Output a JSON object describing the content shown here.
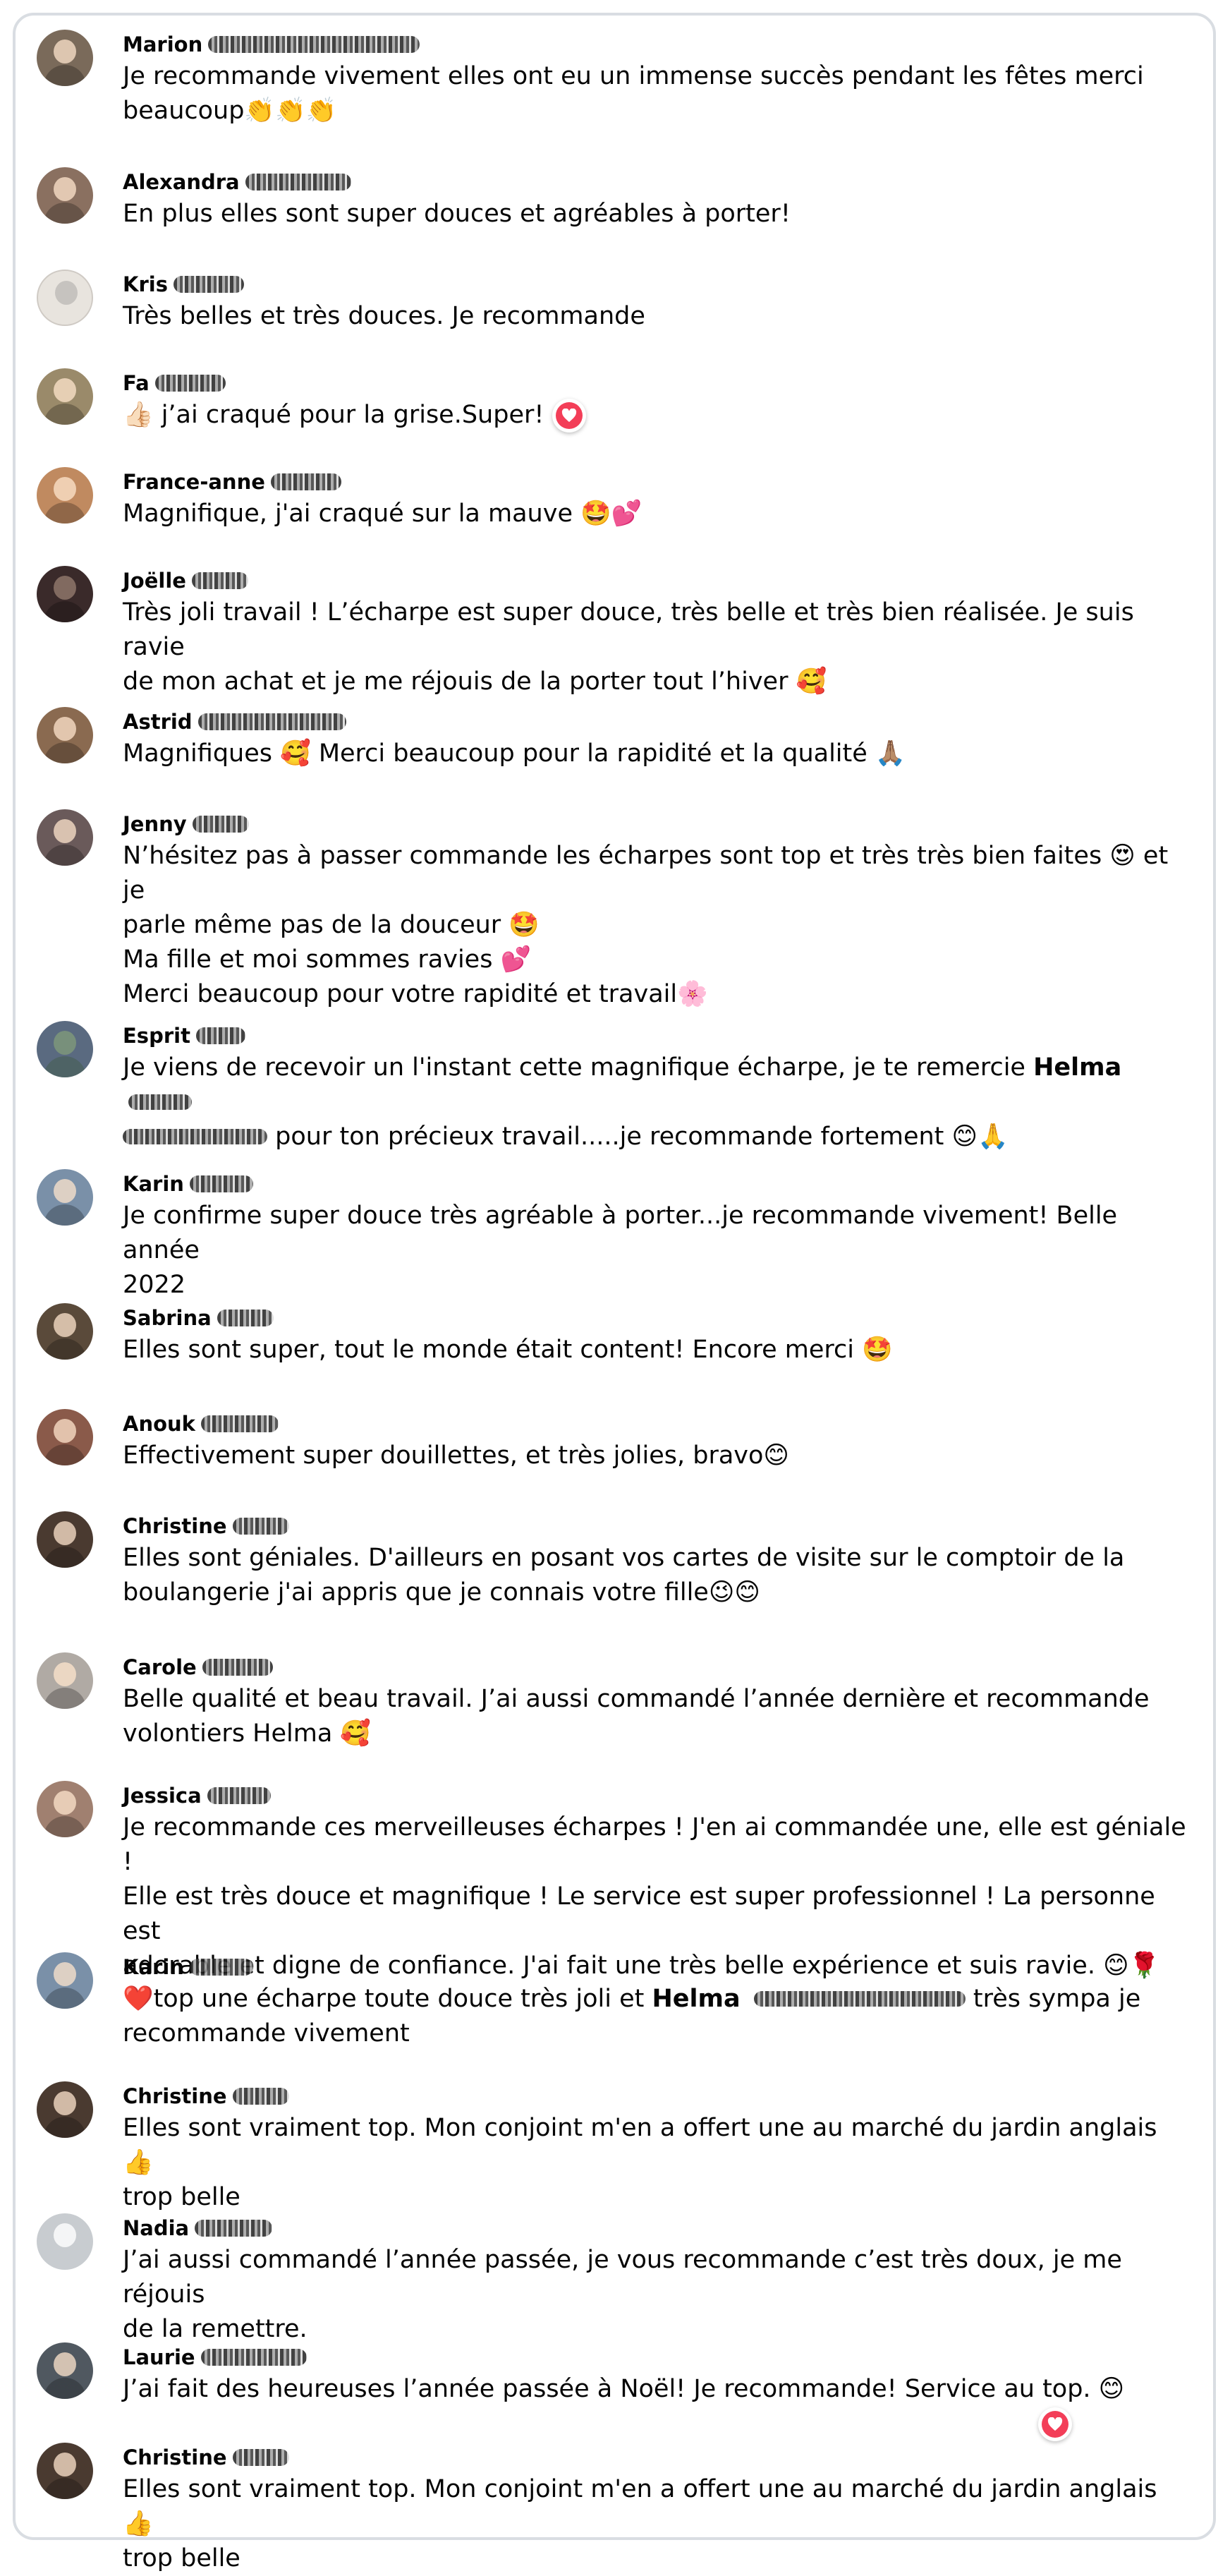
{
  "comments": [
    {
      "name": "Marion",
      "text": "Je recommande vivement elles ont eu un immense succès pendant les fêtes merci\nbeaucoup👏👏👏",
      "avatar_color": "#7a6a5a"
    },
    {
      "name": "Alexandra",
      "text": "En plus elles sont super douces et agréables à porter!",
      "avatar_color": "#8a7060"
    },
    {
      "name": "Kris",
      "text": "Très belles et très douces. Je recommande",
      "avatar_color": "#e8e4de"
    },
    {
      "name": "Fa",
      "text": "👍🏻 j’ai craqué pour la grise.Super!",
      "avatar_color": "#9a8a6a"
    },
    {
      "name": "France-anne",
      "text": "Magnifique, j'ai craqué sur la mauve 🤩💕",
      "avatar_color": "#c08a60"
    },
    {
      "name": "Joëlle",
      "text": "Très joli travail ! L’écharpe est super douce, très belle et très bien réalisée. Je suis ravie\nde mon achat et je me réjouis de la porter tout l’hiver 🥰",
      "avatar_color": "#3a2a2a"
    },
    {
      "name": "Astrid",
      "text": "Magnifiques 🥰 Merci beaucoup pour la rapidité et la qualité 🙏🏽",
      "avatar_color": "#8a6a50"
    },
    {
      "name": "Jenny",
      "text": "N’hésitez pas à passer commande les écharpes sont top et très très bien faites 😍 et je\nparle même pas de la douceur 🤩\nMa fille et moi sommes ravies 💕\nMerci beaucoup pour votre rapidité et travail🌸",
      "avatar_color": "#6a5a5a"
    },
    {
      "name": "Esprit",
      "text": "Je viens de recevoir un l'instant cette magnifique écharpe, je te remercie",
      "mention": "Helma",
      "text_after": "pour ton précieux travail.....je recommande fortement 😊🙏",
      "avatar_color": "#5a6a80"
    },
    {
      "name": "Karin",
      "text": "Je confirme super douce très agréable à porter...je recommande vivement! Belle année\n2022",
      "avatar_color": "#7a90a8"
    },
    {
      "name": "Sabrina",
      "text": "Elles sont super, tout le monde était content! Encore merci 🤩",
      "avatar_color": "#5a4a3a"
    },
    {
      "name": "Anouk",
      "text": "Effectivement super douillettes, et très jolies, bravo😊",
      "avatar_color": "#8a5a4a"
    },
    {
      "name": "Christine",
      "text": "Elles sont géniales. D'ailleurs en posant vos cartes de visite sur le comptoir de la\nboulangerie j'ai appris que je connais votre fille😉😊",
      "avatar_color": "#4a3a30"
    },
    {
      "name": "Carole",
      "text": "Belle qualité et beau travail. J’ai aussi commandé l’année dernière et recommande\nvolontiers Helma 🥰",
      "avatar_color": "#b0aaa4"
    },
    {
      "name": "Jessica",
      "text": "Je recommande ces merveilleuses écharpes ! J'en ai commandée une, elle est géniale !\nElle est très douce et magnifique ! Le service est super professionnel ! La personne est\nadorable et digne de confiance. J'ai fait une très belle expérience et suis ravie. 😊🌹",
      "avatar_color": "#a08070"
    },
    {
      "name": "Karin",
      "text_before": "❤️top une écharpe toute douce très joli et",
      "mention": "Helma",
      "text_after": "très sympa je\nrecommande vivement",
      "avatar_color": "#7a90a8"
    },
    {
      "name": "Christine",
      "text": "Elles sont vraiment top. Mon conjoint m'en a offert une au marché du jardin anglais 👍\ntrop belle",
      "avatar_color": "#4a3a30"
    },
    {
      "name": "Nadia",
      "text": "J’ai aussi commandé l’année passée, je vous recommande c’est très doux, je me réjouis\nde la remettre.",
      "avatar_color": "#c8ccd0"
    },
    {
      "name": "Laurie",
      "text": "J’ai fait des heureuses l’année passée à Noël! Je recommande! Service au top. 😊",
      "avatar_color": "#505860"
    },
    {
      "name": "Christine",
      "text": "Elles sont vraiment top. Mon conjoint m'en a offert une au marché du jardin anglais 👍\ntrop belle",
      "avatar_color": "#4a3a30"
    }
  ],
  "reaction_icon": "heart-reaction-icon",
  "reaction_color": "#f33e58",
  "border_color": "#d9dde2"
}
